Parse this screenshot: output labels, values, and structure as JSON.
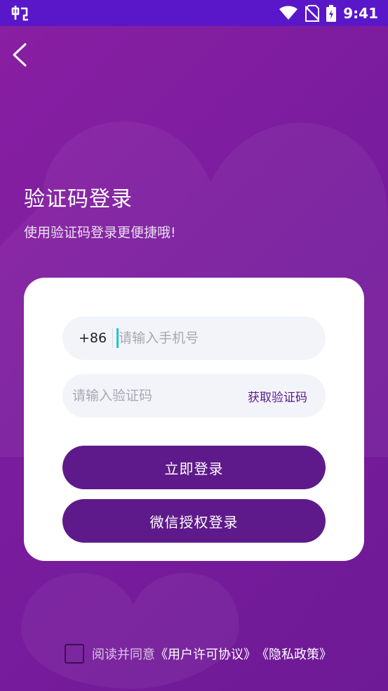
{
  "status_bar": {
    "time": "9:41",
    "app_icon": "bug-icon",
    "icons": [
      "wifi-icon",
      "no-sim-icon",
      "battery-charging-icon"
    ]
  },
  "header": {
    "back_icon": "chevron-left-icon"
  },
  "hero": {
    "title": "验证码登录",
    "subtitle": "使用验证码登录更便捷哦!"
  },
  "form": {
    "country_code": "+86",
    "phone_placeholder": "请输入手机号",
    "code_placeholder": "请输入验证码",
    "get_code_label": "获取验证码",
    "login_label": "立即登录",
    "wechat_label": "微信授权登录"
  },
  "agreement": {
    "checked": false,
    "prefix": "阅读并同意",
    "user_agreement": "《用户许可协议》",
    "privacy_policy": "《隐私政策》"
  },
  "colors": {
    "status_bar": "#5a17c9",
    "background": "#7a1c9e",
    "button": "#5e1a8a",
    "accent_text": "#5b1a8f",
    "caret": "#1fc7c7"
  }
}
